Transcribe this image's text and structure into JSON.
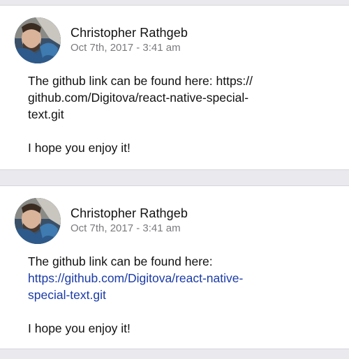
{
  "posts": [
    {
      "author": "Christopher Rathgeb",
      "timestamp": "Oct 7th, 2017 - 3:41 am",
      "text_lines": [
        "The github link can be found here: https://",
        "github.com/Digitova/react-native-special-",
        "text.git"
      ],
      "closing": "I hope you enjoy it!"
    },
    {
      "author": "Christopher Rathgeb",
      "timestamp": "Oct 7th, 2017 - 3:41 am",
      "intro": "The github link can be found here:",
      "link_lines": [
        "https://github.com/Digitova/react-native-",
        "special-text.git"
      ],
      "closing": "I hope you enjoy it!"
    }
  ],
  "colors": {
    "link": "#1a3aa8",
    "text": "#111111",
    "timestamp": "#7b7b80",
    "background": "#e9e9ee",
    "card": "#ffffff"
  },
  "icons": {
    "avatar": "author-avatar-photo"
  }
}
